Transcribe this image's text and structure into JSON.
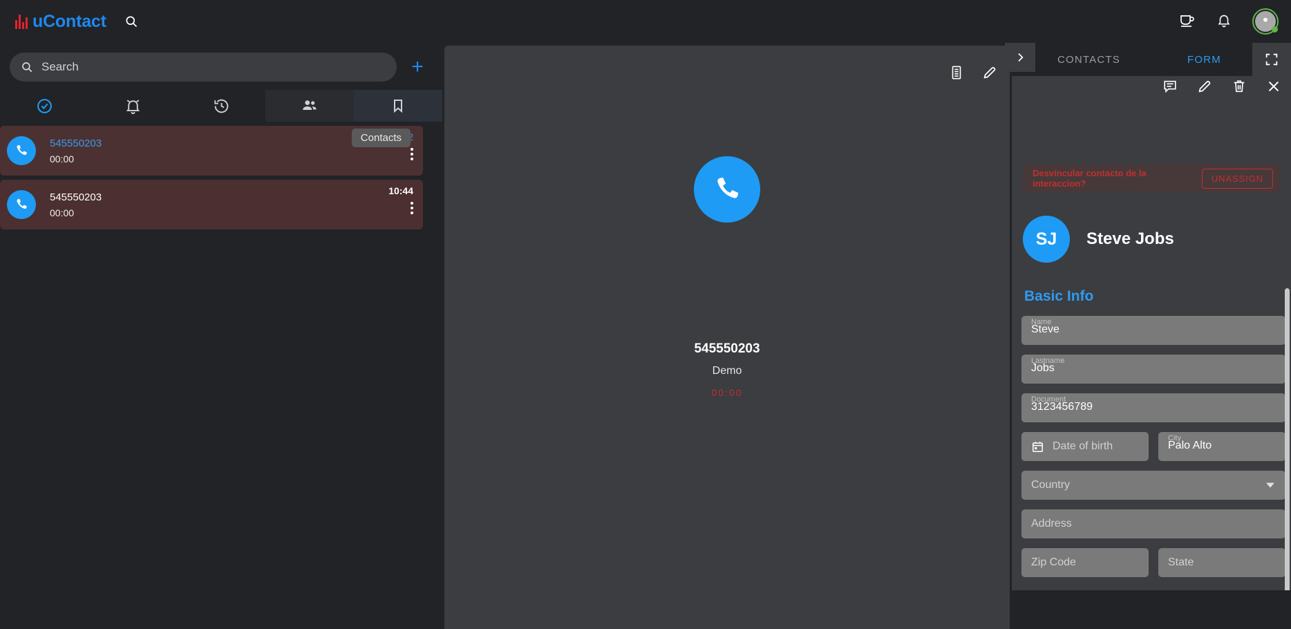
{
  "app": {
    "brand": "uContact",
    "accent_blue": "#1e88f0",
    "logo_red": "#e8232a"
  },
  "topbar": {
    "search_icon": "search-icon",
    "coffee_icon": "coffee-cup-icon",
    "bell_icon": "notification-bell-icon",
    "avatar_label": "user-avatar"
  },
  "left_panel": {
    "search": {
      "placeholder": "Search",
      "value": ""
    },
    "add_button": "+",
    "tabs": [
      {
        "name": "check-circle",
        "icon": "check-circle-icon",
        "active": false
      },
      {
        "name": "alarm",
        "icon": "alarm-bell-icon",
        "active": false
      },
      {
        "name": "history",
        "icon": "history-clock-icon",
        "active": false
      },
      {
        "name": "people",
        "icon": "people-group-icon",
        "active": false
      },
      {
        "name": "bookmark",
        "icon": "bookmark-icon",
        "active": true
      }
    ],
    "tooltip": "Contacts",
    "conversations": [
      {
        "number": "545550203",
        "duration": "00:00",
        "time": "12:32",
        "selected": true,
        "number_color": "blue",
        "time_color": "blue"
      },
      {
        "number": "545550203",
        "duration": "00:00",
        "time": "10:44",
        "selected": false,
        "number_color": "white",
        "time_color": "white"
      }
    ]
  },
  "center_panel": {
    "actions": [
      {
        "name": "notes-list-icon"
      },
      {
        "name": "edit-pencil-icon"
      }
    ],
    "hero_icon": "phone-call-icon",
    "number": "545550203",
    "campaign": "Demo",
    "timer": "00:00",
    "timer_color": "#c0302f"
  },
  "right_panel": {
    "collapse_icon": "chevron-right-icon",
    "tabs": [
      {
        "label": "CONTACTS",
        "active": false
      },
      {
        "label": "FORM",
        "active": true
      }
    ],
    "expand_icon": "fullscreen-expand-icon",
    "toolbar": [
      {
        "name": "comment-list-icon"
      },
      {
        "name": "edit-pencil-icon"
      },
      {
        "name": "delete-trash-icon"
      },
      {
        "name": "close-x-icon"
      }
    ],
    "unassign": {
      "question": "Desvincular contacto de la interaccion?",
      "button": "UNASSIGN",
      "color": "#c0302f"
    },
    "contact": {
      "initials": "SJ",
      "full_name": "Steve Jobs"
    },
    "section_title": "Basic Info",
    "fields": [
      {
        "label": "Name",
        "value": "Steve",
        "placeholder": "Name",
        "filled": true,
        "type": "text"
      },
      {
        "label": "Lastname",
        "value": "Jobs",
        "placeholder": "Lastname",
        "filled": true,
        "type": "text"
      },
      {
        "label": "Document",
        "value": "3123456789",
        "placeholder": "Document",
        "filled": true,
        "type": "text"
      },
      {
        "label": "",
        "value": "",
        "placeholder": "Date of birth",
        "filled": false,
        "type": "date"
      },
      {
        "label": "City",
        "value": "Palo Alto",
        "placeholder": "City",
        "filled": true,
        "type": "text"
      },
      {
        "label": "",
        "value": "",
        "placeholder": "Country",
        "filled": false,
        "type": "select"
      },
      {
        "label": "",
        "value": "",
        "placeholder": "Address",
        "filled": false,
        "type": "text"
      },
      {
        "label": "",
        "value": "",
        "placeholder": "Zip Code",
        "filled": false,
        "type": "text"
      },
      {
        "label": "",
        "value": "",
        "placeholder": "State",
        "filled": false,
        "type": "text"
      }
    ]
  }
}
